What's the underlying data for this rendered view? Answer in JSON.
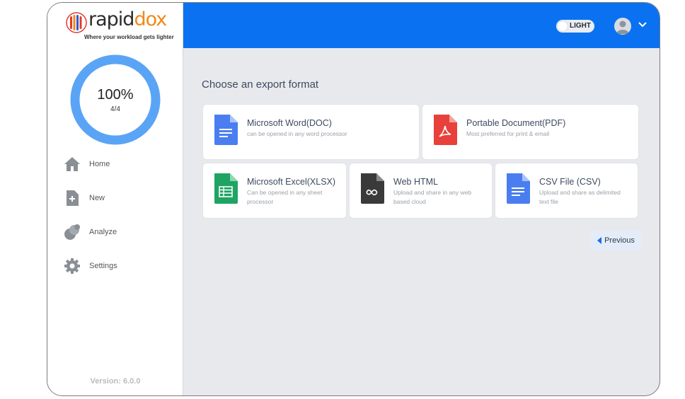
{
  "app": {
    "logo_main": "rapid",
    "logo_accent": "dox",
    "tagline": "Where your workload gets lighter",
    "version": "Version: 6.0.0"
  },
  "progress": {
    "percent_label": "100%",
    "count_label": "4/4",
    "value": 1.0,
    "color": "#5aa4f6"
  },
  "nav": [
    {
      "label": "Home",
      "icon": "home-icon"
    },
    {
      "label": "New",
      "icon": "new-file-icon"
    },
    {
      "label": "Analyze",
      "icon": "analyze-icon"
    },
    {
      "label": "Settings",
      "icon": "gear-icon"
    }
  ],
  "header": {
    "theme_label": "LIGHT",
    "accent": "#0a72f0"
  },
  "main": {
    "heading": "Choose an export format",
    "formats": [
      {
        "title": "Microsoft Word(DOC)",
        "desc": "can be opened in any word processor",
        "icon": "word-doc-icon",
        "color": "#4a7ef0"
      },
      {
        "title": "Portable Document(PDF)",
        "desc": "Most preferred for print & email",
        "icon": "pdf-icon",
        "color": "#e8403a"
      },
      {
        "title": "Microsoft Excel(XLSX)",
        "desc": "Can be opened in any sheet processor",
        "icon": "excel-sheet-icon",
        "color": "#1fa463"
      },
      {
        "title": "Web HTML",
        "desc": "Upload and share in any web based cloud",
        "icon": "web-html-icon",
        "color": "#3a3a3a"
      },
      {
        "title": "CSV File (CSV)",
        "desc": "Upload and share as delimited text file",
        "icon": "csv-file-icon",
        "color": "#4a7ef0"
      }
    ],
    "previous_label": "Previous"
  }
}
